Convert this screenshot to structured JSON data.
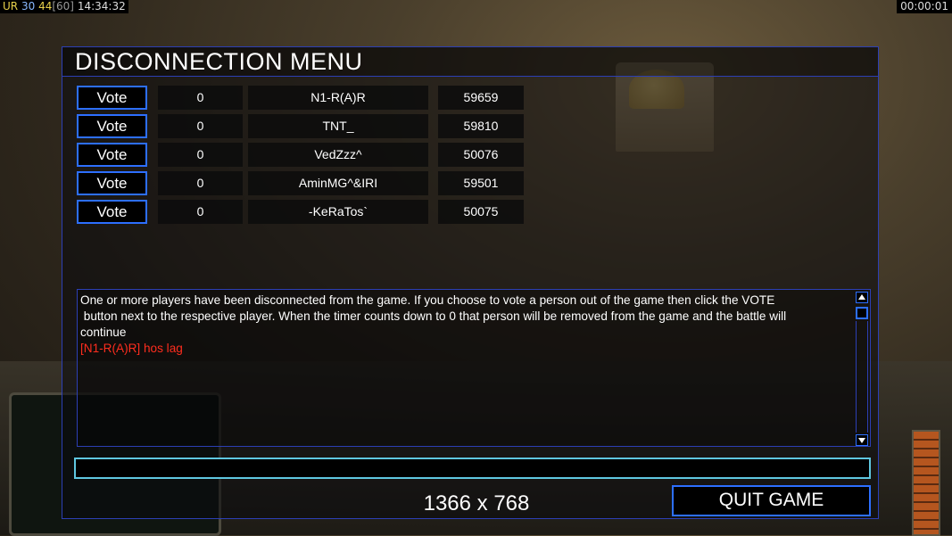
{
  "hud": {
    "ur_label": "UR",
    "fps_current": "30",
    "fps_avg": "44",
    "fps_limit": "[60]",
    "clock": "14:34:32",
    "game_timer": "00:00:01"
  },
  "dialog": {
    "title": "DISCONNECTION MENU",
    "vote_label": "Vote",
    "players": [
      {
        "votes": "0",
        "name": "N1-R(A)R",
        "ping": "59659"
      },
      {
        "votes": "0",
        "name": "TNT_",
        "ping": "59810"
      },
      {
        "votes": "0",
        "name": "VedZzz^",
        "ping": "50076"
      },
      {
        "votes": "0",
        "name": "AminMG^&IRI",
        "ping": "59501"
      },
      {
        "votes": "0",
        "name": "-KeRaTos`",
        "ping": "50075"
      }
    ],
    "message_lines": [
      "One or more players have been disconnected from the game. If you choose to vote a person out of the game then click the VOTE",
      " button next to the respective player. When the timer counts down to 0 that person will be removed from the game and the battle will",
      "continue"
    ],
    "chat_message": "[N1-R(A)R] hos lag",
    "chat_input_value": "",
    "resolution_text": "1366 x 768",
    "quit_label": "QUIT GAME"
  },
  "colors": {
    "border_blue": "#2c3fb5",
    "button_blue": "#2d6fff",
    "input_cyan": "#5fc7e0",
    "chat_red": "#ff2d1e"
  }
}
